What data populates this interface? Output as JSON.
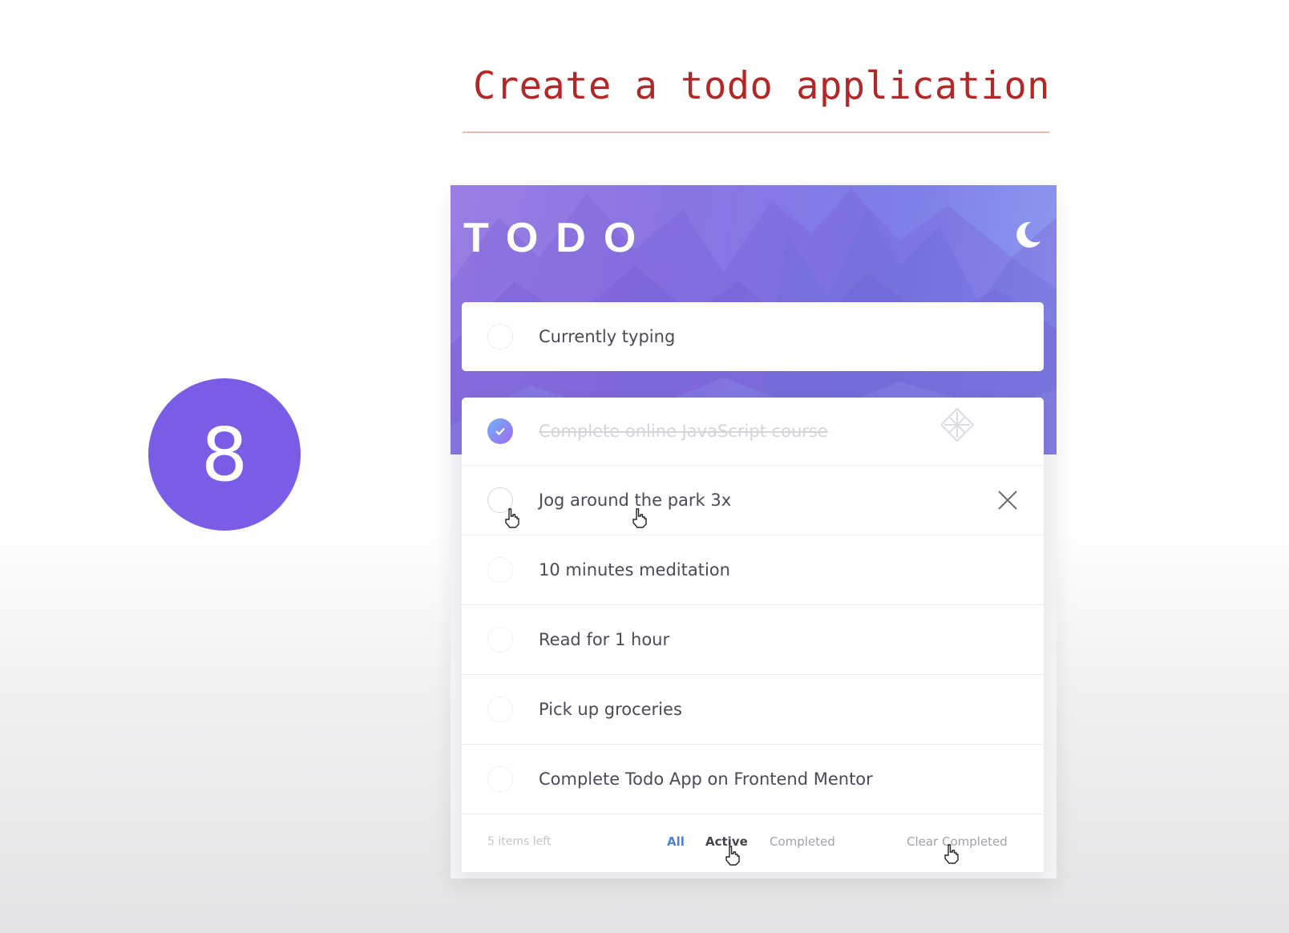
{
  "slide": {
    "title": "Create a todo application",
    "step_number": "8"
  },
  "app": {
    "logo": "TODO",
    "theme_toggle_icon": "moon-icon",
    "new_todo": {
      "value": "Currently typing"
    },
    "todos": [
      {
        "text": "Complete online JavaScript course",
        "completed": true
      },
      {
        "text": "Jog around the park 3x",
        "completed": false
      },
      {
        "text": "10 minutes meditation",
        "completed": false
      },
      {
        "text": "Read for 1 hour",
        "completed": false
      },
      {
        "text": "Pick up groceries",
        "completed": false
      },
      {
        "text": "Complete Todo App on Frontend Mentor",
        "completed": false
      }
    ],
    "footer": {
      "items_left": "5 items left",
      "filter_all": "All",
      "filter_active": "Active",
      "filter_completed": "Completed",
      "clear_completed": "Clear Completed"
    }
  },
  "colors": {
    "title_red": "#b22828",
    "badge_purple": "#7b5ce6",
    "active_filter_blue": "#4d7fd6",
    "check_gradient_start": "#6fb2f6",
    "check_gradient_end": "#a06af2"
  }
}
